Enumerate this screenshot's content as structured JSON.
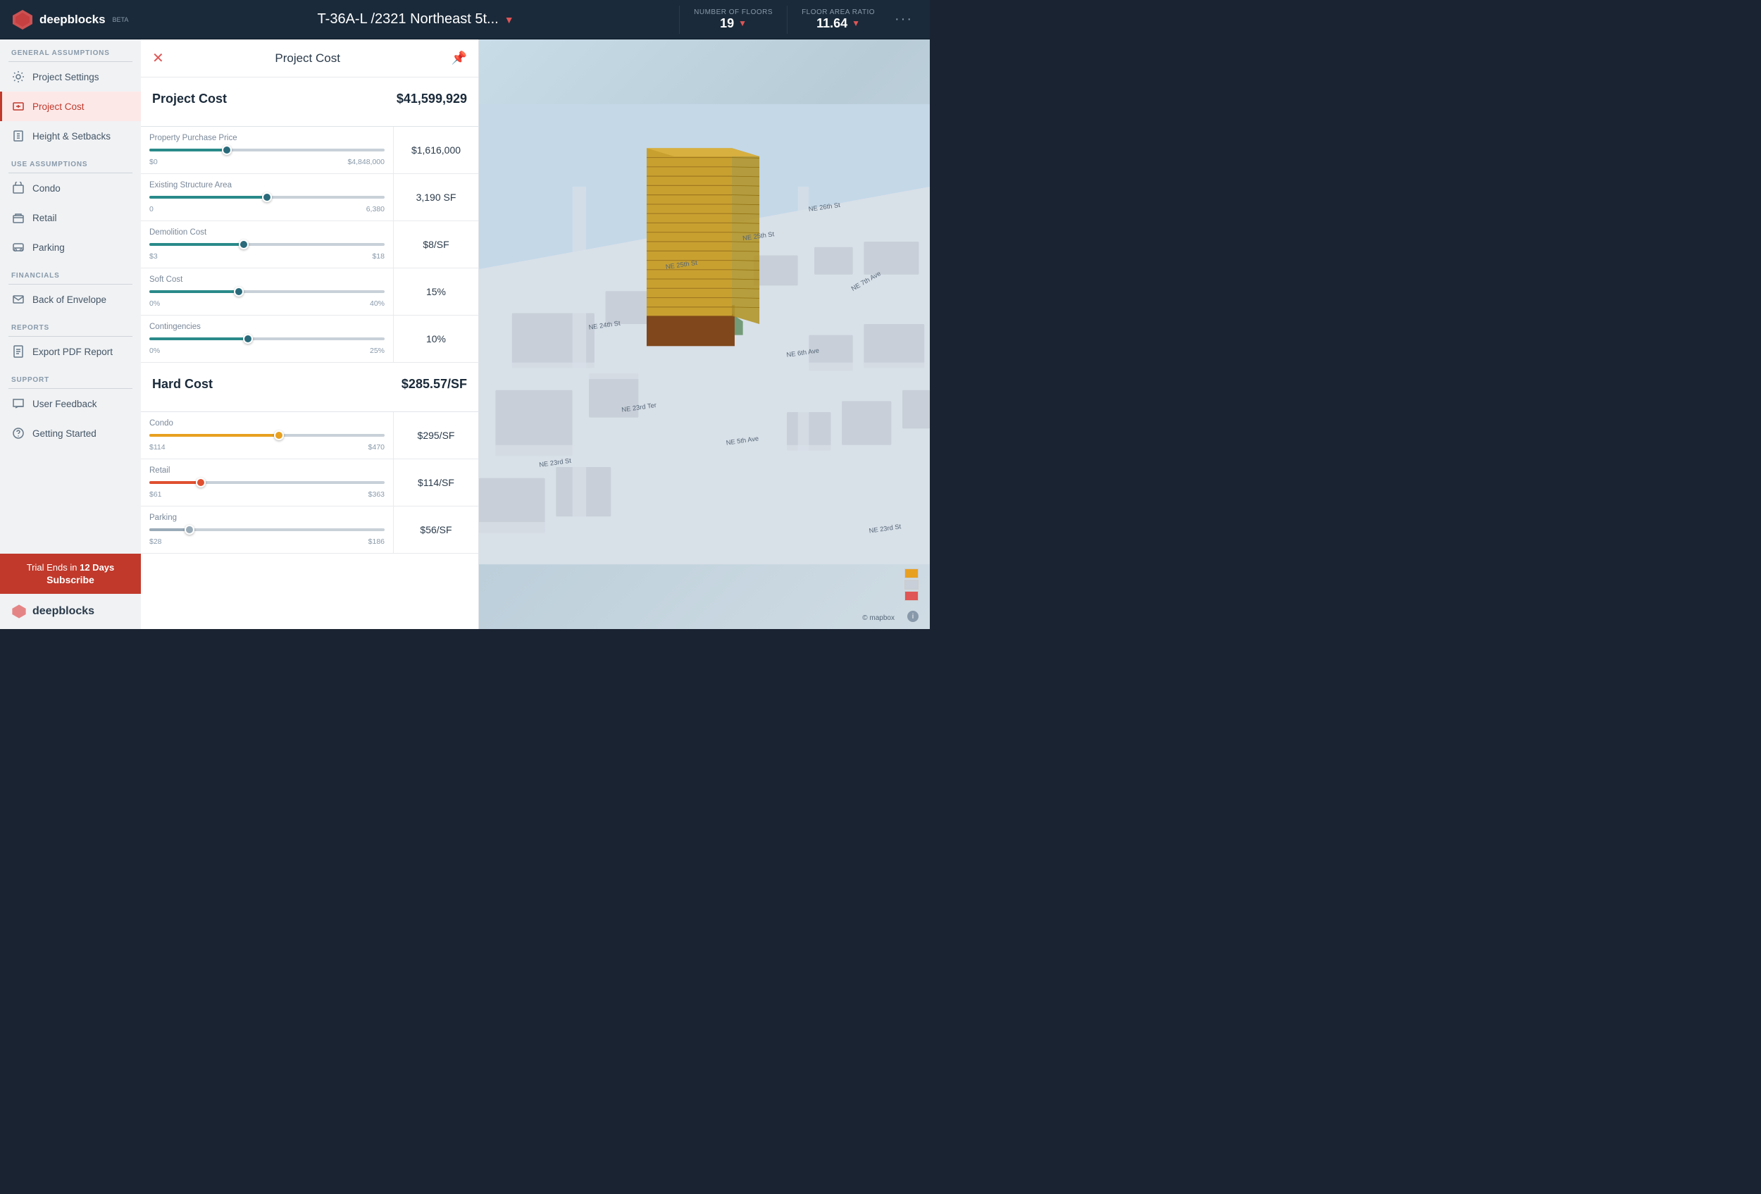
{
  "header": {
    "logo_text": "deepblocks",
    "beta_label": "BETA",
    "project_title": "T-36A-L /2321 Northeast 5t...",
    "metrics": [
      {
        "label": "Number of Floors",
        "value": "19",
        "has_arrow": true
      },
      {
        "label": "Floor Area Ratio",
        "value": "11.64",
        "has_arrow": true
      }
    ],
    "menu_dots": "···"
  },
  "sidebar": {
    "sections": [
      {
        "label": "General Assumptions",
        "items": [
          {
            "id": "project-settings",
            "label": "Project Settings",
            "active": false
          },
          {
            "id": "project-cost",
            "label": "Project Cost",
            "active": true
          },
          {
            "id": "height-setbacks",
            "label": "Height & Setbacks",
            "active": false
          }
        ]
      },
      {
        "label": "Use Assumptions",
        "items": [
          {
            "id": "condo",
            "label": "Condo",
            "active": false
          },
          {
            "id": "retail",
            "label": "Retail",
            "active": false
          },
          {
            "id": "parking",
            "label": "Parking",
            "active": false
          }
        ]
      },
      {
        "label": "Financials",
        "items": [
          {
            "id": "back-of-envelope",
            "label": "Back of Envelope",
            "active": false
          }
        ]
      },
      {
        "label": "Reports",
        "items": [
          {
            "id": "export-pdf",
            "label": "Export PDF Report",
            "active": false
          }
        ]
      },
      {
        "label": "Support",
        "items": [
          {
            "id": "user-feedback",
            "label": "User Feedback",
            "active": false
          },
          {
            "id": "getting-started",
            "label": "Getting Started",
            "active": false
          }
        ]
      }
    ],
    "trial": {
      "text": "Trial Ends in ",
      "days": "12 Days",
      "subscribe": "Subscribe"
    },
    "footer_logo": "deepblocks"
  },
  "panel": {
    "title": "Project Cost",
    "sections": [
      {
        "id": "project-cost",
        "title": "Project Cost",
        "total": "$41,599,929",
        "rows": [
          {
            "label": "Property Purchase Price",
            "slider_fill_pct": 33,
            "slider_color": "teal",
            "range_min": "$0",
            "range_max": "$4,848,000",
            "value": "$1,616,000"
          },
          {
            "label": "Existing Structure Area",
            "slider_fill_pct": 50,
            "slider_color": "teal",
            "range_min": "0",
            "range_max": "6,380",
            "value": "3,190 SF"
          },
          {
            "label": "Demolition Cost",
            "slider_fill_pct": 40,
            "slider_color": "teal",
            "range_min": "$3",
            "range_max": "$18",
            "value": "$8/SF"
          },
          {
            "label": "Soft Cost",
            "slider_fill_pct": 38,
            "slider_color": "teal",
            "range_min": "0%",
            "range_max": "40%",
            "value": "15%"
          },
          {
            "label": "Contingencies",
            "slider_fill_pct": 42,
            "slider_color": "teal",
            "range_min": "0%",
            "range_max": "25%",
            "value": "10%"
          }
        ]
      },
      {
        "id": "hard-cost",
        "title": "Hard Cost",
        "total": "$285.57/SF",
        "rows": [
          {
            "label": "Condo",
            "slider_fill_pct": 55,
            "slider_color": "orange",
            "range_min": "$114",
            "range_max": "$470",
            "value": "$295/SF"
          },
          {
            "label": "Retail",
            "slider_fill_pct": 22,
            "slider_color": "red",
            "range_min": "$61",
            "range_max": "$363",
            "value": "$114/SF"
          },
          {
            "label": "Parking",
            "slider_fill_pct": 17,
            "slider_color": "gray",
            "range_min": "$28",
            "range_max": "$186",
            "value": "$56/SF"
          }
        ]
      }
    ]
  },
  "map": {
    "streets": [
      "NE 26th St",
      "NE 25th St",
      "NE 24th St",
      "NE 23rd Ter",
      "NE 23rd St",
      "NE 7th Ave",
      "NE 6th Ave",
      "NE 5th Ave"
    ]
  }
}
